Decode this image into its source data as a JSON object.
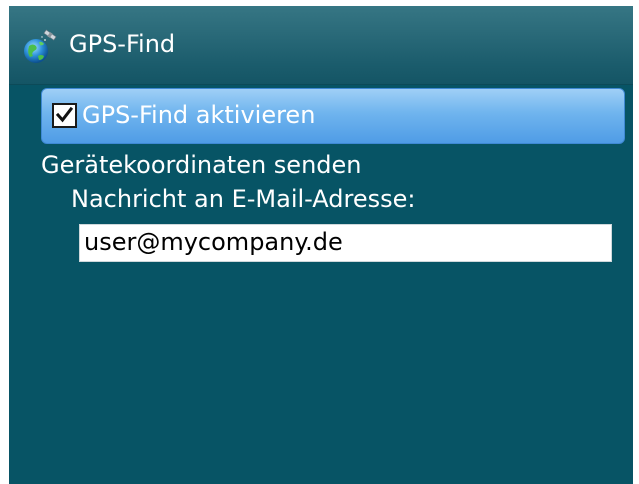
{
  "titlebar": {
    "title": "GPS-Find",
    "icon": "satellite-globe-icon"
  },
  "options": {
    "enable_label": "GPS-Find aktivieren",
    "enable_checked": true,
    "send_coordinates_label": "Gerätekoordinaten senden",
    "email_label": "Nachricht an E-Mail-Adresse:",
    "email_value": "user@mycompany.de"
  },
  "colors": {
    "screen_background": "#075465",
    "selection_highlight": "#6fb4ee",
    "text": "#ffffff"
  }
}
